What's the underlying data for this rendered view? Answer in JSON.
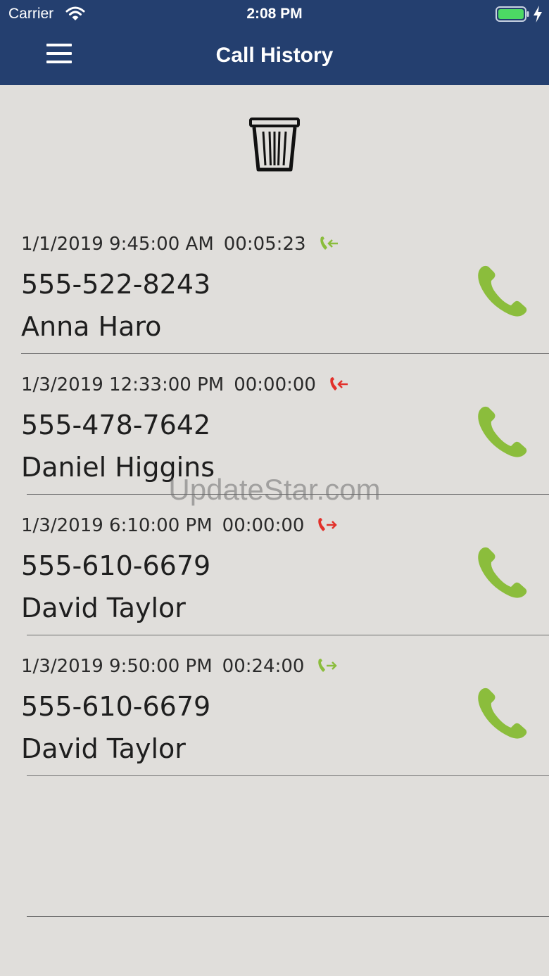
{
  "status_bar": {
    "carrier": "Carrier",
    "time": "2:08 PM"
  },
  "header": {
    "title": "Call History"
  },
  "colors": {
    "header_bg": "#243f6f",
    "accent_green": "#8bbd3c",
    "missed_red": "#e2312b",
    "background": "#e0dedb"
  },
  "calls": [
    {
      "datetime": "1/1/2019 9:45:00 AM",
      "duration": "00:05:23",
      "number": "555-522-8243",
      "name": "Anna Haro",
      "direction": "incoming",
      "direction_icon": "incoming-call-icon",
      "direction_color": "#8bbd3c"
    },
    {
      "datetime": "1/3/2019 12:33:00 PM",
      "duration": "00:00:00",
      "number": "555-478-7642",
      "name": "Daniel Higgins",
      "direction": "incoming-missed",
      "direction_icon": "missed-incoming-call-icon",
      "direction_color": "#e2312b"
    },
    {
      "datetime": "1/3/2019 6:10:00 PM",
      "duration": "00:00:00",
      "number": "555-610-6679",
      "name": "David Taylor",
      "direction": "outgoing-missed",
      "direction_icon": "missed-outgoing-call-icon",
      "direction_color": "#e2312b"
    },
    {
      "datetime": "1/3/2019 9:50:00 PM",
      "duration": "00:24:00",
      "number": "555-610-6679",
      "name": "David Taylor",
      "direction": "outgoing",
      "direction_icon": "outgoing-call-icon",
      "direction_color": "#8bbd3c"
    }
  ],
  "watermark": "UpdateStar.com"
}
